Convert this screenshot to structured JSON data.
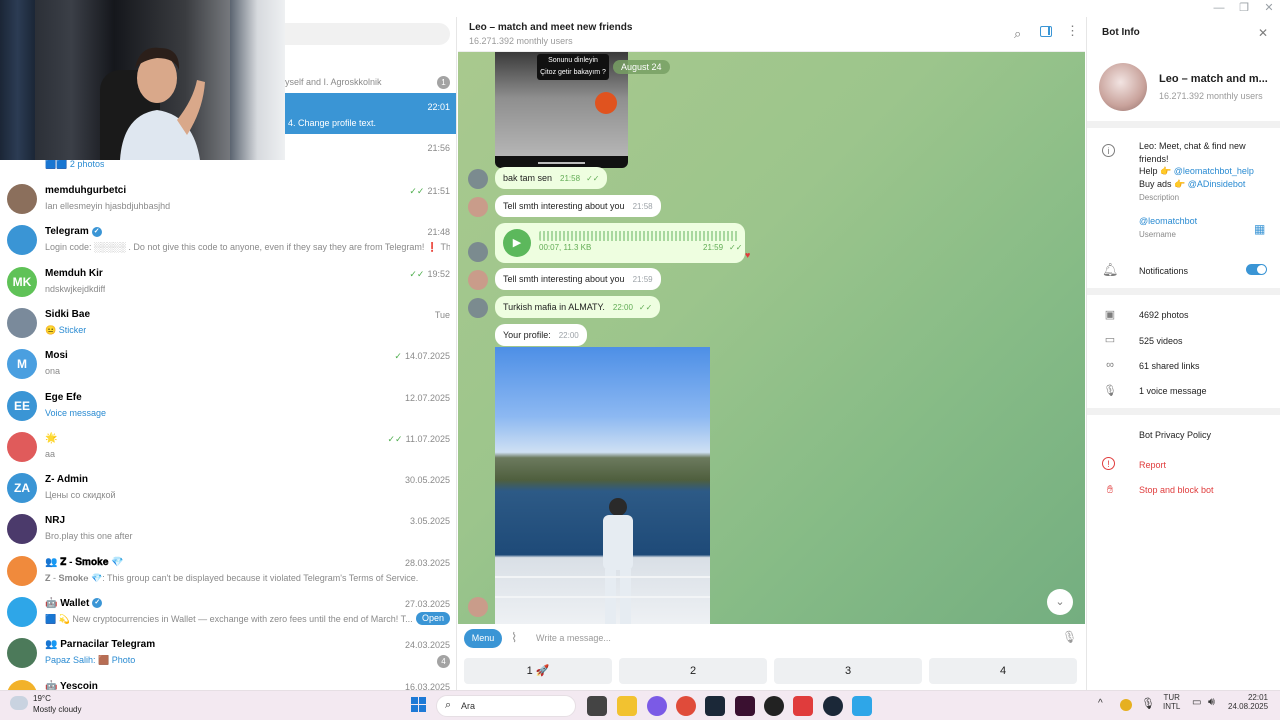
{
  "chat_list": {
    "partial_rows": [
      {
        "preview": "yself and I. Agroskkolnik",
        "badge": "1"
      },
      {
        "time": "22:01",
        "preview": "4. Change profile text."
      },
      {
        "time": "21:56",
        "preview": ""
      },
      {
        "preview": "2 photos"
      }
    ],
    "chats": [
      {
        "name": "memduhgurbetci",
        "preview": "Ian ellesmeyin hjasbdjuhbasjhd",
        "time": "21:51",
        "ticks": "✓✓",
        "avatar_color": "#8b6f5c"
      },
      {
        "name": "Telegram",
        "verified": true,
        "preview": "Login code: ░░░░░ . Do not give this code to anyone, even if they say they are from Telegram! ❗ This ...",
        "time": "21:48",
        "avatar_color": "#3a95d5"
      },
      {
        "name": "Memduh Kir",
        "initials": "MK",
        "preview": "ndskwjkejdkdiff",
        "time": "19:52",
        "ticks": "✓✓",
        "avatar_color": "#5fc257"
      },
      {
        "name": "Sidki Bae",
        "preview": "😐 Sticker",
        "preview_blue": true,
        "time": "Tue",
        "avatar_color": "#7a8a9b"
      },
      {
        "name": "Mosi",
        "initials": "M",
        "preview": "ona",
        "time": "14.07.2025",
        "ticks": "✓",
        "avatar_color": "#4a9fe0"
      },
      {
        "name": "Ege Efe",
        "initials": "EE",
        "preview": "Voice message",
        "preview_blue": true,
        "time": "12.07.2025",
        "avatar_color": "#3a95d5"
      },
      {
        "name": "🌟",
        "preview": "aa",
        "time": "11.07.2025",
        "ticks": "✓✓",
        "avatar_color": "#e05b5b"
      },
      {
        "name": "Z- Admin",
        "initials": "ZA",
        "preview": "Цены со скидкой",
        "time": "30.05.2025",
        "avatar_color": "#3a95d5"
      },
      {
        "name": "NRJ",
        "preview": "Bro.play this one after",
        "time": "3.05.2025",
        "avatar_color": "#4b3a6b"
      },
      {
        "name": "👥 𝐙 - 𝐒𝐦𝐨𝐤𝐞 💎",
        "preview": "𝐙 - 𝐒𝐦𝐨𝐤𝐞 💎: This group can't be displayed because it violated Telegram's Terms of Service.",
        "time": "28.03.2025",
        "avatar_color": "#f08a3c"
      },
      {
        "name": "🤖 Wallet",
        "verified": true,
        "preview": "🟦 💫 New cryptocurrencies in Wallet — exchange with zero fees until the end of March! T...",
        "time": "27.03.2025",
        "open_label": "Open",
        "avatar_color": "#2ea6e8"
      },
      {
        "name": "👥 Parnacilar Telegram",
        "preview": "Papaz Salih: 🟫 Photo",
        "preview_blue": true,
        "time": "24.03.2025",
        "badge": "4",
        "avatar_color": "#4c7a5a"
      },
      {
        "name": "🤖 Yescoin",
        "preview": "",
        "time": "16.03.2025",
        "avatar_color": "#f2b22a"
      }
    ]
  },
  "chat": {
    "title": "Leo – match and meet new friends",
    "subtitle": "16.271.392 monthly users",
    "date_chip": "August 24",
    "video_caption_1": "Sonunu dinleyin",
    "video_caption_2": "Çitoz getir bakayım ?",
    "messages": [
      {
        "text": "bak tam sen",
        "time": "21:58",
        "ticks": "✓✓",
        "out": true
      },
      {
        "text": "Tell smth interesting about you",
        "time": "21:58",
        "out": false
      },
      {
        "voice": true,
        "meta": "00:07, 11.3 KB",
        "time": "21:59",
        "ticks": "✓✓",
        "reaction": "♥"
      },
      {
        "text": "Tell smth interesting about you",
        "time": "21:59",
        "out": false
      },
      {
        "text": "Turkish mafia in ALMATY.",
        "time": "22:00",
        "ticks": "✓✓",
        "out": true
      },
      {
        "text": "Your profile:",
        "time": "22:00",
        "out": false
      }
    ],
    "input_placeholder": "Write a message...",
    "menu_label": "Menu",
    "keyboard": [
      "1 🚀",
      "2",
      "3",
      "4"
    ]
  },
  "bot_info": {
    "header": "Bot Info",
    "name": "Leo – match and m...",
    "users": "16.271.392 monthly users",
    "description_lines": [
      "Leo: Meet, chat & find new",
      "friends!"
    ],
    "help_prefix": "Help 👉 ",
    "help_link": "@leomatchbot_help",
    "ads_prefix": "Buy ads 👉 ",
    "ads_link": "@ADinsidebot",
    "description_label": "Description",
    "username": "@leomatchbot",
    "username_label": "Username",
    "notifications": "Notifications",
    "photos": "4692 photos",
    "videos": "525 videos",
    "links": "61 shared links",
    "voice": "1 voice message",
    "privacy": "Bot Privacy Policy",
    "report": "Report",
    "block": "Stop and block bot"
  },
  "taskbar": {
    "temp": "19°C",
    "weather": "Mostly cloudy",
    "search": "Ara",
    "lang1": "TUR",
    "lang2": "INTL",
    "time": "22:01",
    "date": "24.08.2025"
  }
}
